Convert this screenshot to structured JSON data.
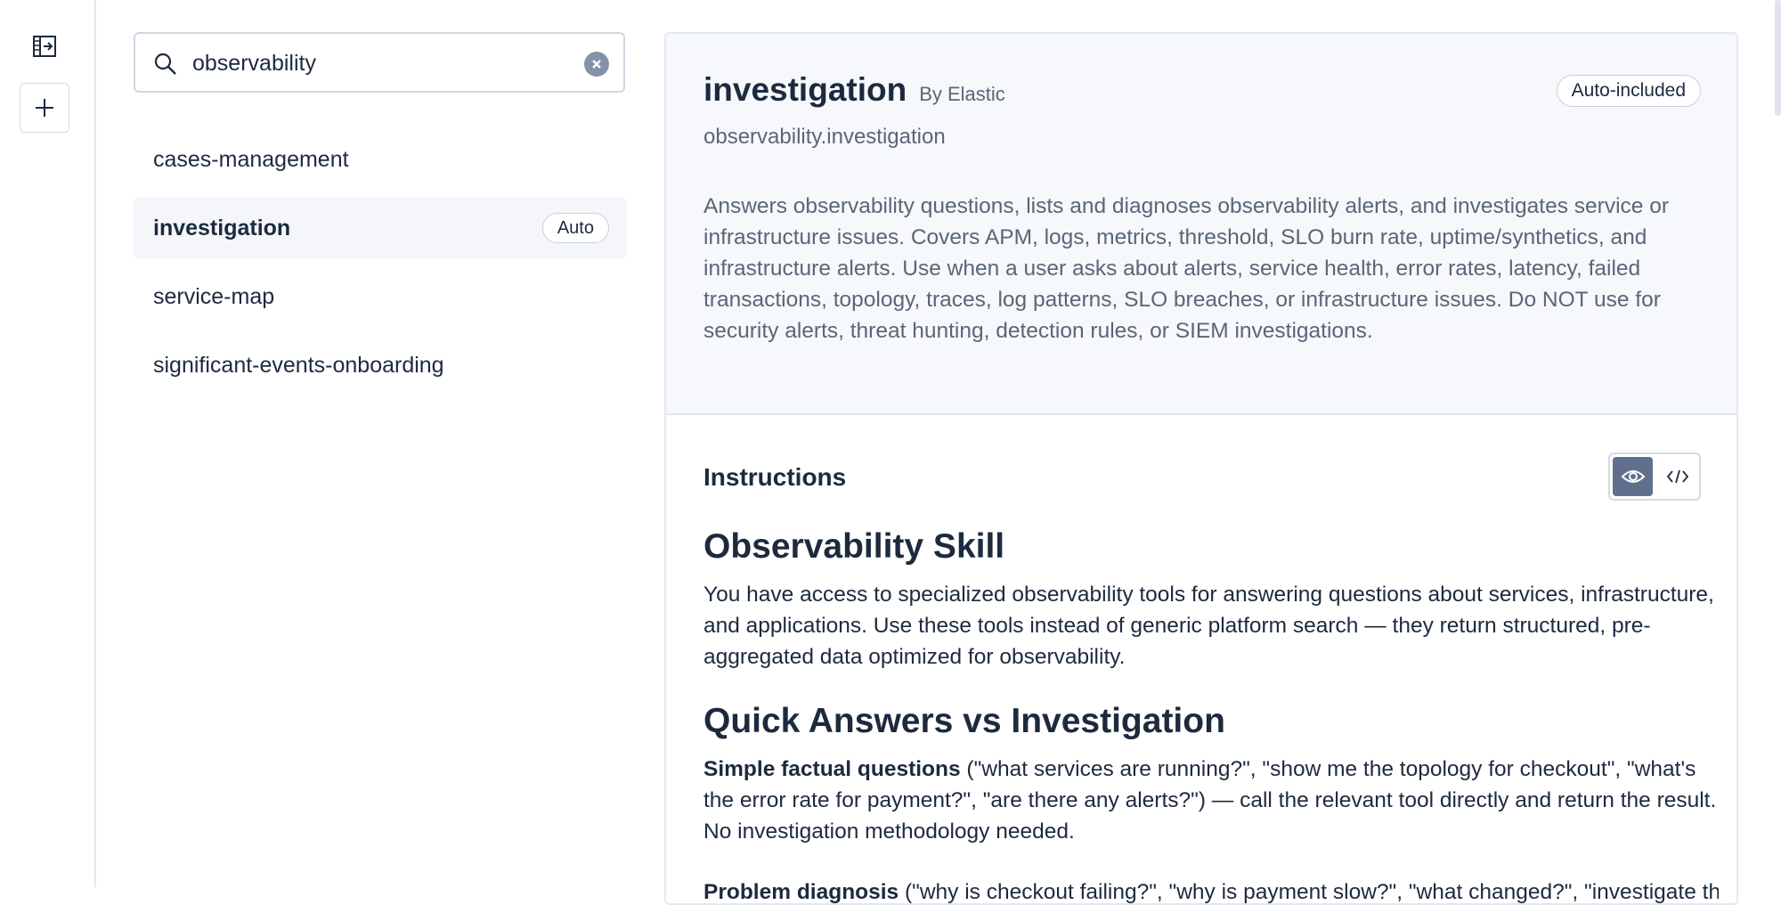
{
  "search": {
    "value": "observability"
  },
  "skills": [
    {
      "label": "cases-management",
      "badge": ""
    },
    {
      "label": "investigation",
      "badge": "Auto"
    },
    {
      "label": "service-map",
      "badge": ""
    },
    {
      "label": "significant-events-onboarding",
      "badge": ""
    }
  ],
  "detail": {
    "title": "investigation",
    "by": "By Elastic",
    "badge": "Auto-included",
    "id": "observability.investigation",
    "description": "Answers observability questions, lists and diagnoses observability alerts, and investigates service or infrastructure issues. Covers APM, logs, metrics, threshold, SLO burn rate, uptime/synthetics, and infrastructure alerts. Use when a user asks about alerts, service health, error rates, latency, failed transactions, topology, traces, log patterns, SLO breaches, or infrastructure issues. Do NOT use for security alerts, threat hunting, detection rules, or SIEM investigations.",
    "instructions_label": "Instructions",
    "heading1": "Observability Skill",
    "para1": "You have access to specialized observability tools for answering questions about services, infrastructure, and applications. Use these tools instead of generic platform search — they return structured, pre-aggregated data optimized for observability.",
    "heading2": "Quick Answers vs Investigation",
    "para2_bold": "Simple factual questions",
    "para2_rest": " (\"what services are running?\", \"show me the topology for checkout\", \"what's the error rate for payment?\", \"are there any alerts?\") — call the relevant tool directly and return the result. No investigation methodology needed.",
    "para3_bold": "Problem diagnosis",
    "para3_rest": " (\"why is checkout failing?\", \"why is payment slow?\", \"what changed?\", \"investigate this alert\")"
  },
  "icons": {
    "rail_top": "panel-expand-icon",
    "rail_add": "plus-icon",
    "search": "magnifier-icon",
    "clear": "clear-x-icon",
    "view": "eye-icon",
    "code": "code-icon"
  },
  "colors": {
    "text": "#1d2a3e",
    "muted": "#5a6678",
    "header_bg": "#f6f8fb",
    "active_bg": "#f4f6fa",
    "toggle_active": "#5f6f8c"
  }
}
